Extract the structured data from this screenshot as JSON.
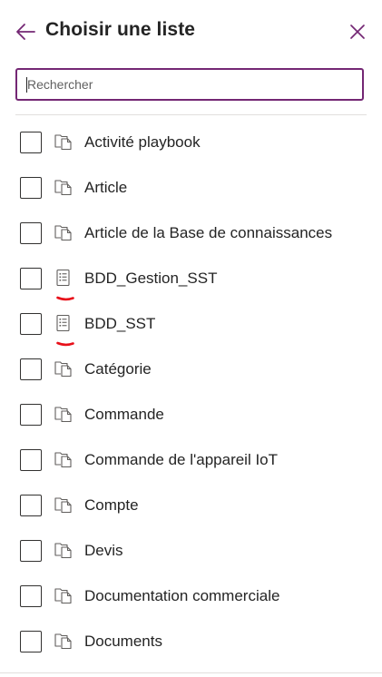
{
  "header": {
    "title": "Choisir une liste",
    "back_icon": "arrow-left-icon",
    "close_icon": "close-icon"
  },
  "search": {
    "placeholder": "Rechercher",
    "value": ""
  },
  "colors": {
    "accent": "#742774",
    "mark": "#e8101a"
  },
  "list": {
    "items": [
      {
        "label": "Activité playbook",
        "icon": "entity-table-icon",
        "checked": false,
        "annotated": false
      },
      {
        "label": "Article",
        "icon": "entity-table-icon",
        "checked": false,
        "annotated": false
      },
      {
        "label": "Article de la Base de connaissances",
        "icon": "entity-table-icon",
        "checked": false,
        "annotated": false
      },
      {
        "label": "BDD_Gestion_SST",
        "icon": "list-document-icon",
        "checked": false,
        "annotated": true
      },
      {
        "label": "BDD_SST",
        "icon": "list-document-icon",
        "checked": false,
        "annotated": true
      },
      {
        "label": "Catégorie",
        "icon": "entity-table-icon",
        "checked": false,
        "annotated": false
      },
      {
        "label": "Commande",
        "icon": "entity-table-icon",
        "checked": false,
        "annotated": false
      },
      {
        "label": "Commande de l'appareil IoT",
        "icon": "entity-table-icon",
        "checked": false,
        "annotated": false
      },
      {
        "label": "Compte",
        "icon": "entity-table-icon",
        "checked": false,
        "annotated": false
      },
      {
        "label": "Devis",
        "icon": "entity-table-icon",
        "checked": false,
        "annotated": false
      },
      {
        "label": "Documentation commerciale",
        "icon": "entity-table-icon",
        "checked": false,
        "annotated": false
      },
      {
        "label": "Documents",
        "icon": "entity-table-icon",
        "checked": false,
        "annotated": false
      }
    ]
  }
}
